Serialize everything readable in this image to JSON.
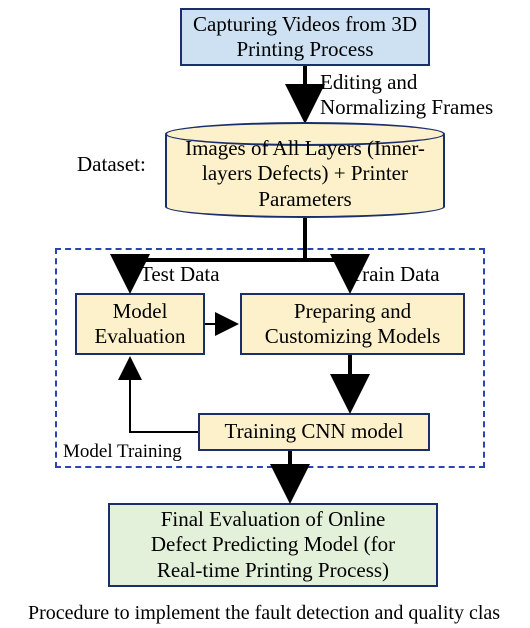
{
  "chart_data": {
    "type": "flowchart",
    "nodes": [
      {
        "id": "capture",
        "label": "Capturing Videos from\n3D Printing Process",
        "shape": "rect",
        "fill": "#cde1f2"
      },
      {
        "id": "dataset",
        "label": "Images of All Layers\n(Inner-layers Defects)\n+ Printer Parameters",
        "shape": "cylinder",
        "fill": "#fdf1cb"
      },
      {
        "id": "eval",
        "label": "Model\nEvaluation",
        "shape": "rect",
        "fill": "#fdf1cb"
      },
      {
        "id": "prepare",
        "label": "Preparing and\nCustomizing Models",
        "shape": "rect",
        "fill": "#fdf1cb"
      },
      {
        "id": "train",
        "label": "Training CNN model",
        "shape": "rect",
        "fill": "#fdf1cb"
      },
      {
        "id": "final",
        "label": "Final Evaluation of Online\nDefect Predicting Model (for\nReal-time Printing Process)",
        "shape": "rect",
        "fill": "#e3f0da"
      }
    ],
    "edges": [
      {
        "from": "capture",
        "to": "dataset",
        "label": "Editing and\nNormalizing Frames"
      },
      {
        "from": "dataset",
        "to": "eval",
        "label": "Test Data"
      },
      {
        "from": "dataset",
        "to": "prepare",
        "label": "Train Data"
      },
      {
        "from": "eval",
        "to": "prepare",
        "label": ""
      },
      {
        "from": "prepare",
        "to": "train",
        "label": ""
      },
      {
        "from": "train",
        "to": "eval",
        "label": ""
      },
      {
        "from": "train",
        "to": "final",
        "label": ""
      }
    ],
    "groups": [
      {
        "id": "model-training",
        "label": "Model Training",
        "contains": [
          "eval",
          "prepare",
          "train"
        ]
      }
    ],
    "side_labels": [
      {
        "text": "Dataset:",
        "near": "dataset"
      }
    ]
  },
  "nodes": {
    "capture": "Capturing Videos from 3D Printing Process",
    "dataset": "Images of All Layers (Inner-layers Defects) + Printer Parameters",
    "eval_l1": "Model",
    "eval_l2": "Evaluation",
    "prepare_l1": "Preparing and",
    "prepare_l2": "Customizing Models",
    "train": "Training CNN model",
    "final_l1": "Final Evaluation of Online",
    "final_l2": "Defect Predicting Model (for",
    "final_l3": "Real-time Printing Process)"
  },
  "labels": {
    "edit_l1": "Editing and",
    "edit_l2": "Normalizing Frames",
    "dataset_side": "Dataset:",
    "test_data": "Test Data",
    "train_data": "Train Data",
    "model_training": "Model Training"
  },
  "caption_fragment": "Procedure to implement the fault detection and quality clas"
}
